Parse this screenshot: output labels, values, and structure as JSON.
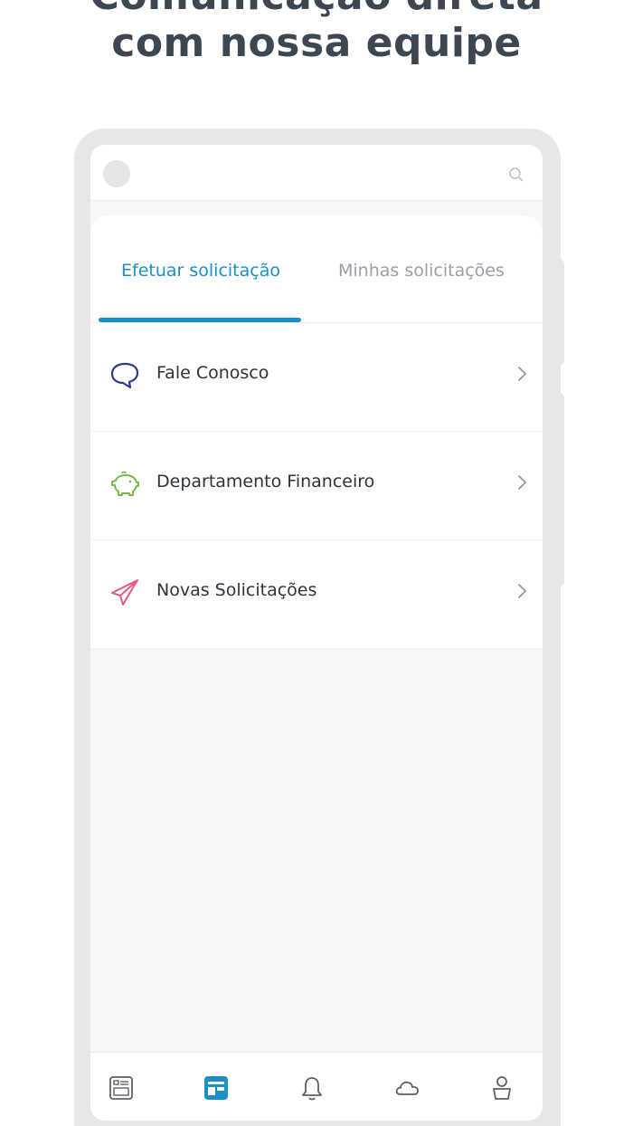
{
  "promo": {
    "headline_line1": "Comunicação direta",
    "headline_line2": "com nossa equipe"
  },
  "header": {
    "avatar_icon": "avatar-placeholder",
    "search_icon": "search-icon"
  },
  "tabs": [
    {
      "label": "Efetuar solicitação",
      "active": true
    },
    {
      "label": "Minhas solicitações",
      "active": false
    }
  ],
  "menu": [
    {
      "label": "Fale Conosco",
      "icon": "chat-bubble-icon",
      "icon_color": "#2b3a8c"
    },
    {
      "label": "Departamento Financeiro",
      "icon": "piggy-bank-icon",
      "icon_color": "#7bb84a"
    },
    {
      "label": "Novas Solicitações",
      "icon": "paper-plane-icon",
      "icon_color": "#e45a8c"
    }
  ],
  "bottom_nav": [
    {
      "icon": "news-icon",
      "active": false
    },
    {
      "icon": "requests-icon",
      "active": true
    },
    {
      "icon": "bell-icon",
      "active": false
    },
    {
      "icon": "cloud-icon",
      "active": false
    },
    {
      "icon": "profile-icon",
      "active": false
    }
  ],
  "colors": {
    "accent": "#1a8fc9",
    "inactive_tab": "#9aa0a7",
    "headline": "#3d4752"
  }
}
